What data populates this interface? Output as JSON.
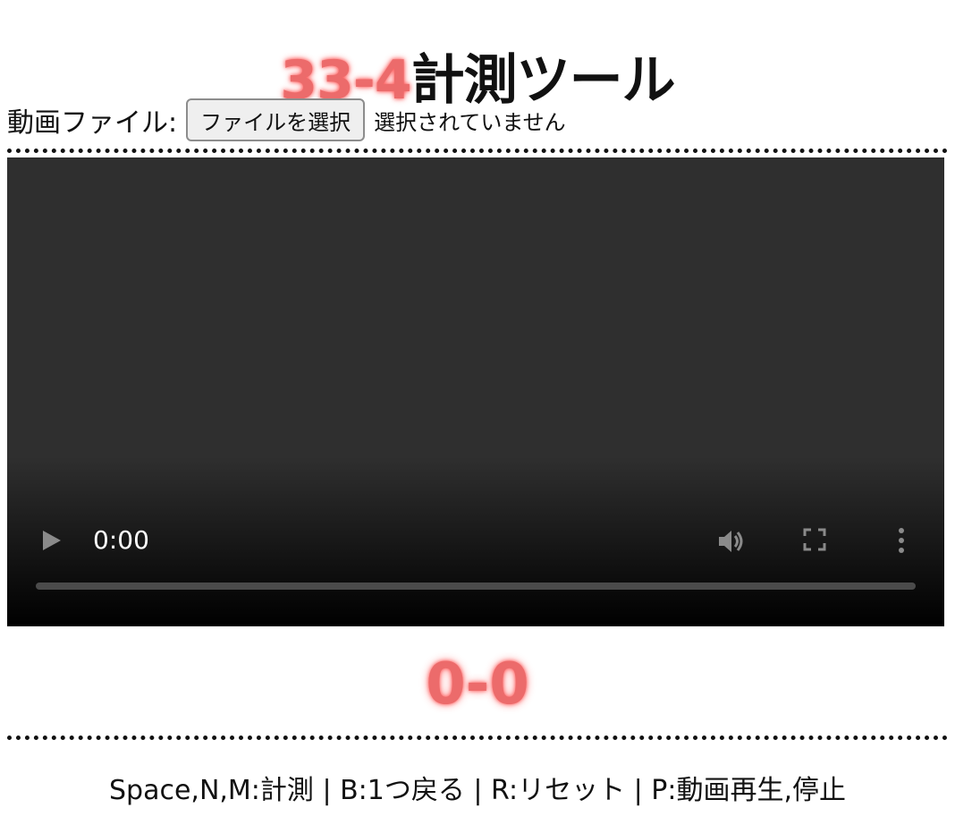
{
  "title": {
    "code": "33-4",
    "name": "計測ツール"
  },
  "file_picker": {
    "label": "動画ファイル:",
    "button_label": "ファイルを選択",
    "status": "選択されていません"
  },
  "video_player": {
    "time": "0:00",
    "progress": 0,
    "controls": [
      "play-icon",
      "volume-icon",
      "fullscreen-icon",
      "more-options-icon"
    ]
  },
  "score": "0-0",
  "shortcuts": "Space,N,M:計測 | B:1つ戻る | R:リセット | P:動画再生,停止",
  "colors": {
    "accent_red": "#ec6b6b",
    "video_background": "#2f2f2f",
    "text": "#111111"
  }
}
